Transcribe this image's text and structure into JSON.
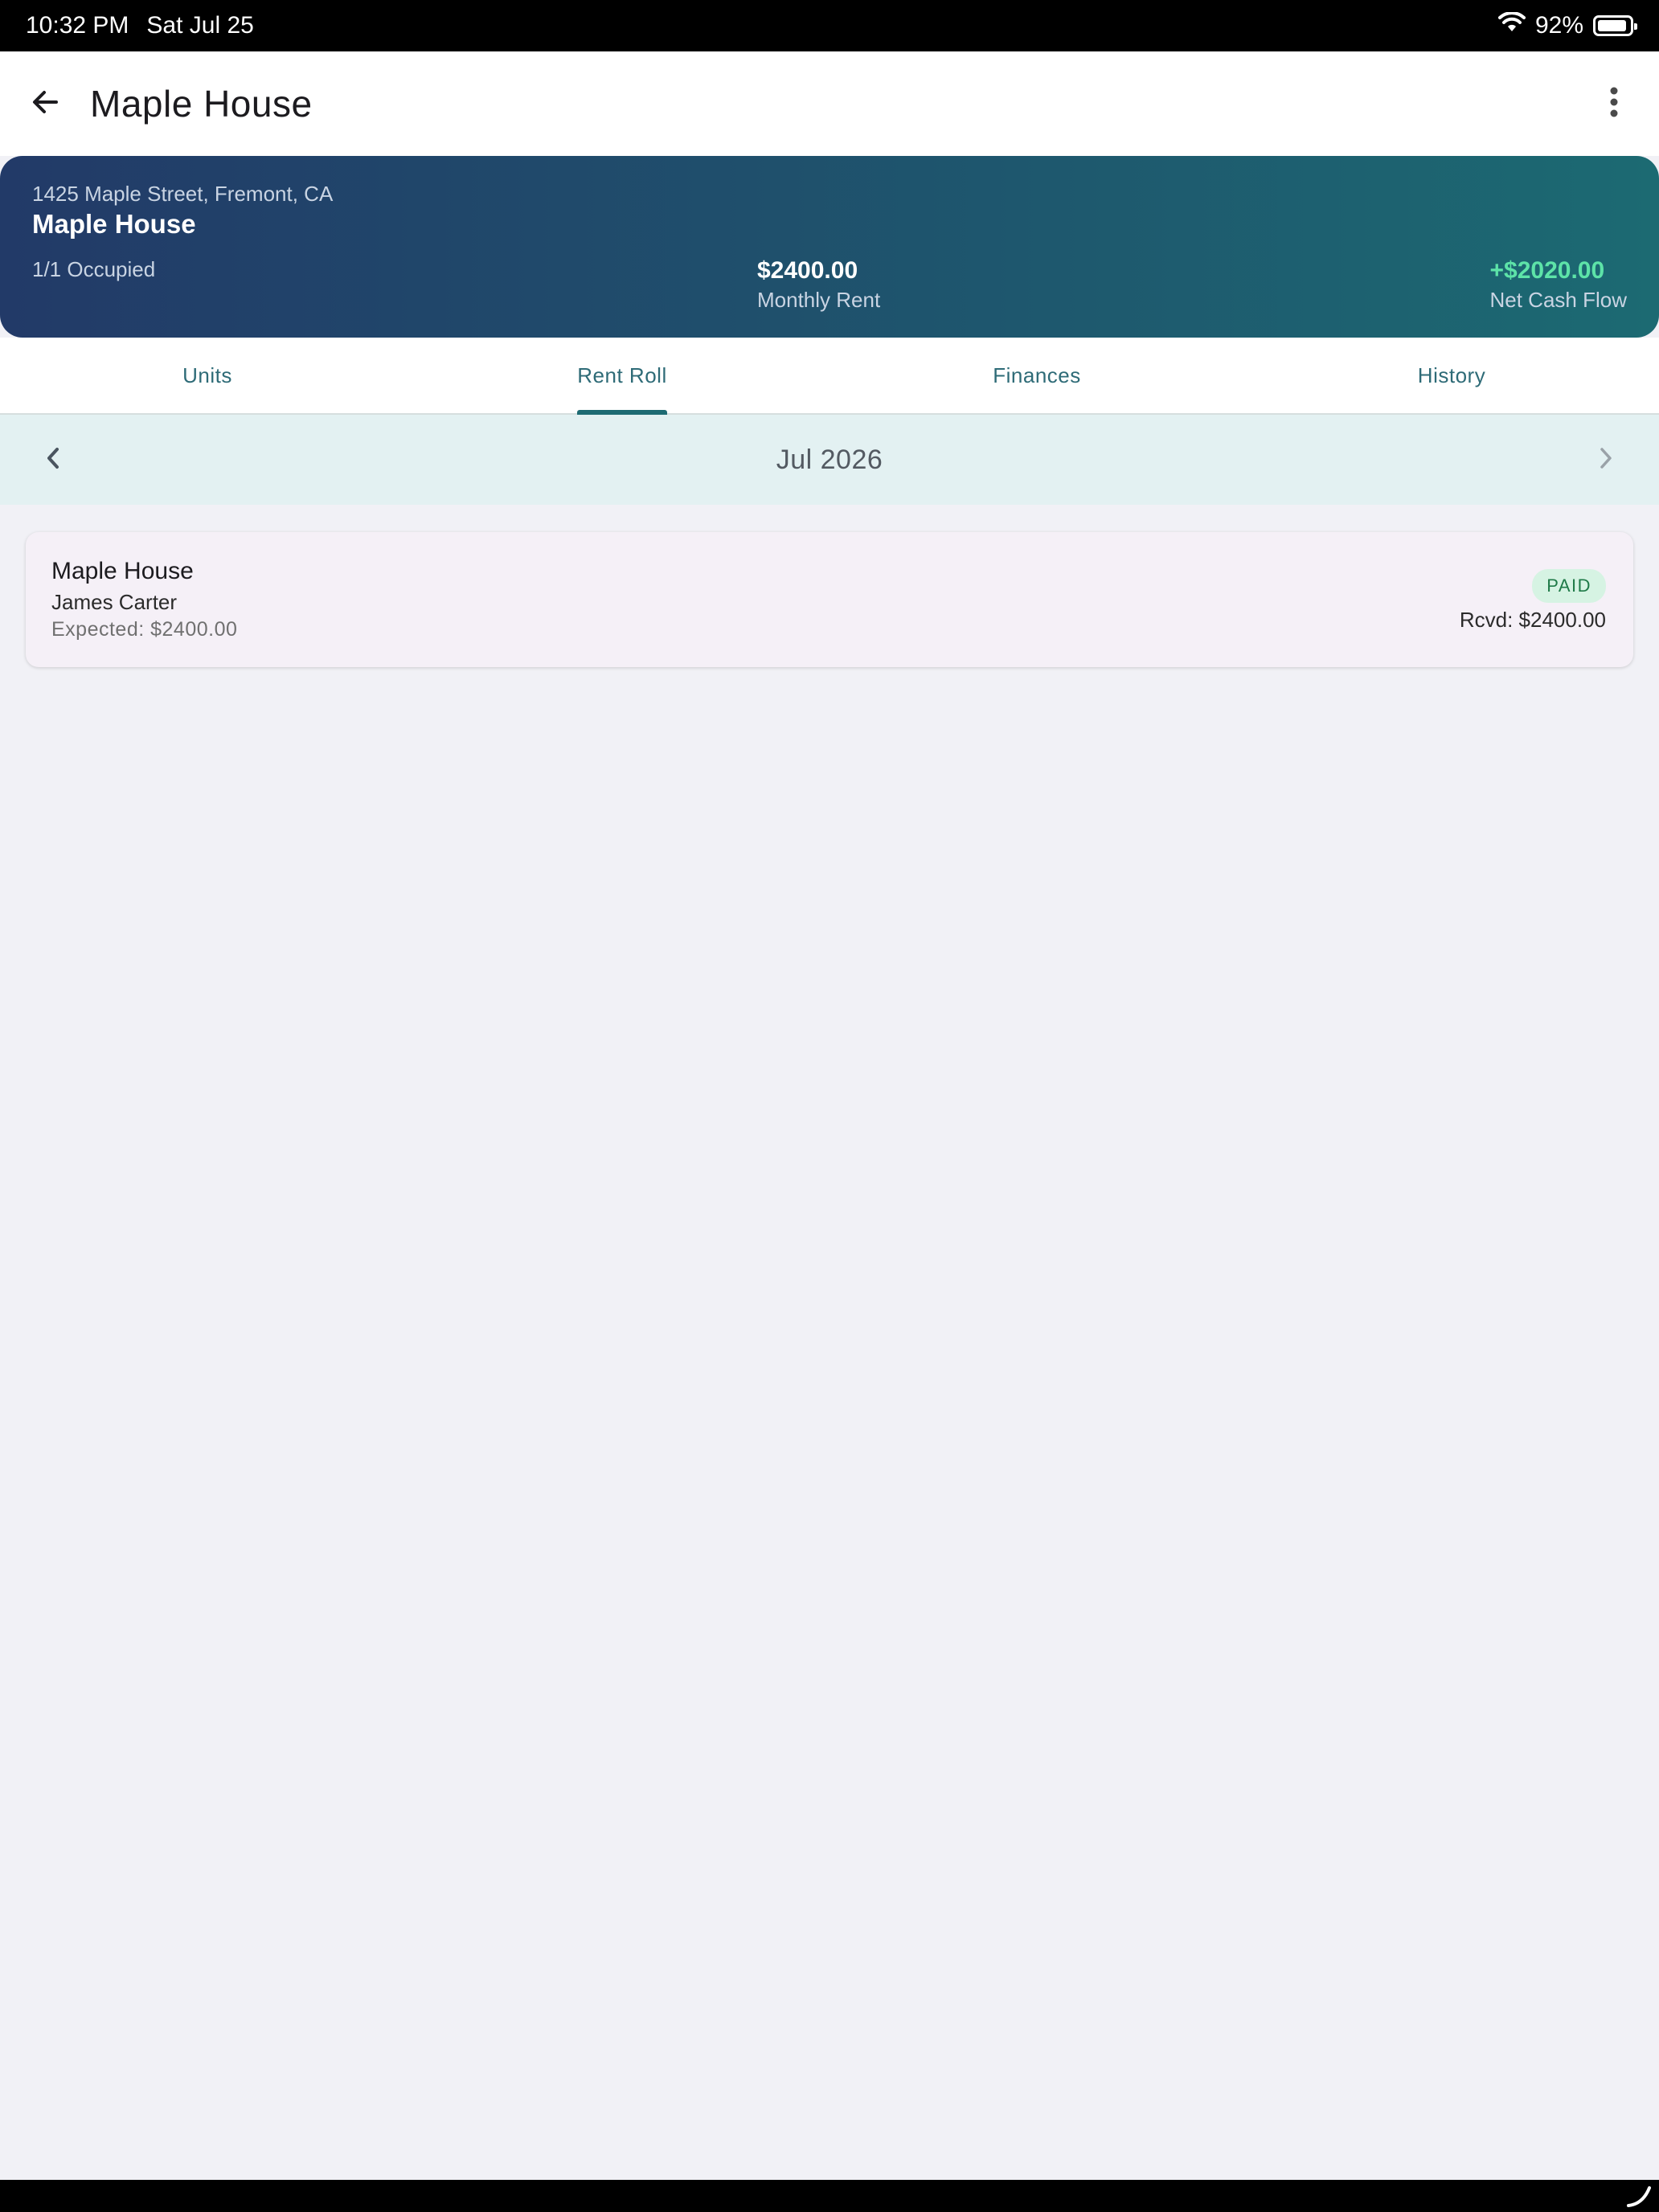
{
  "status_bar": {
    "time": "10:32 PM",
    "date": "Sat Jul 25",
    "battery": "92%",
    "battery_level": 0.92
  },
  "app_bar": {
    "title": "Maple House",
    "back_icon": "arrow-left-icon",
    "menu_icon": "more-vertical-icon"
  },
  "property": {
    "address": "1425 Maple Street, Fremont, CA",
    "name": "Maple House",
    "occupancy": "1/1 Occupied",
    "monthly_rent_value": "$2400.00",
    "monthly_rent_label": "Monthly Rent",
    "net_cash_flow_value": "+$2020.00",
    "net_cash_flow_label": "Net Cash Flow"
  },
  "tabs": [
    {
      "label": "Units",
      "active": false
    },
    {
      "label": "Rent Roll",
      "active": true
    },
    {
      "label": "Finances",
      "active": false
    },
    {
      "label": "History",
      "active": false
    }
  ],
  "month_nav": {
    "label": "Jul 2026"
  },
  "rent_items": [
    {
      "property": "Maple House",
      "tenant": "James Carter",
      "expected": "Expected: $2400.00",
      "status": "PAID",
      "received": "Rcvd: $2400.00"
    }
  ],
  "colors": {
    "header_gradient_start": "#223a68",
    "header_gradient_end": "#1c6a72",
    "accent": "#1e6b73",
    "positive": "#5de3a8",
    "paid_badge_bg": "#d6f3e3",
    "paid_badge_text": "#1f7a48"
  }
}
